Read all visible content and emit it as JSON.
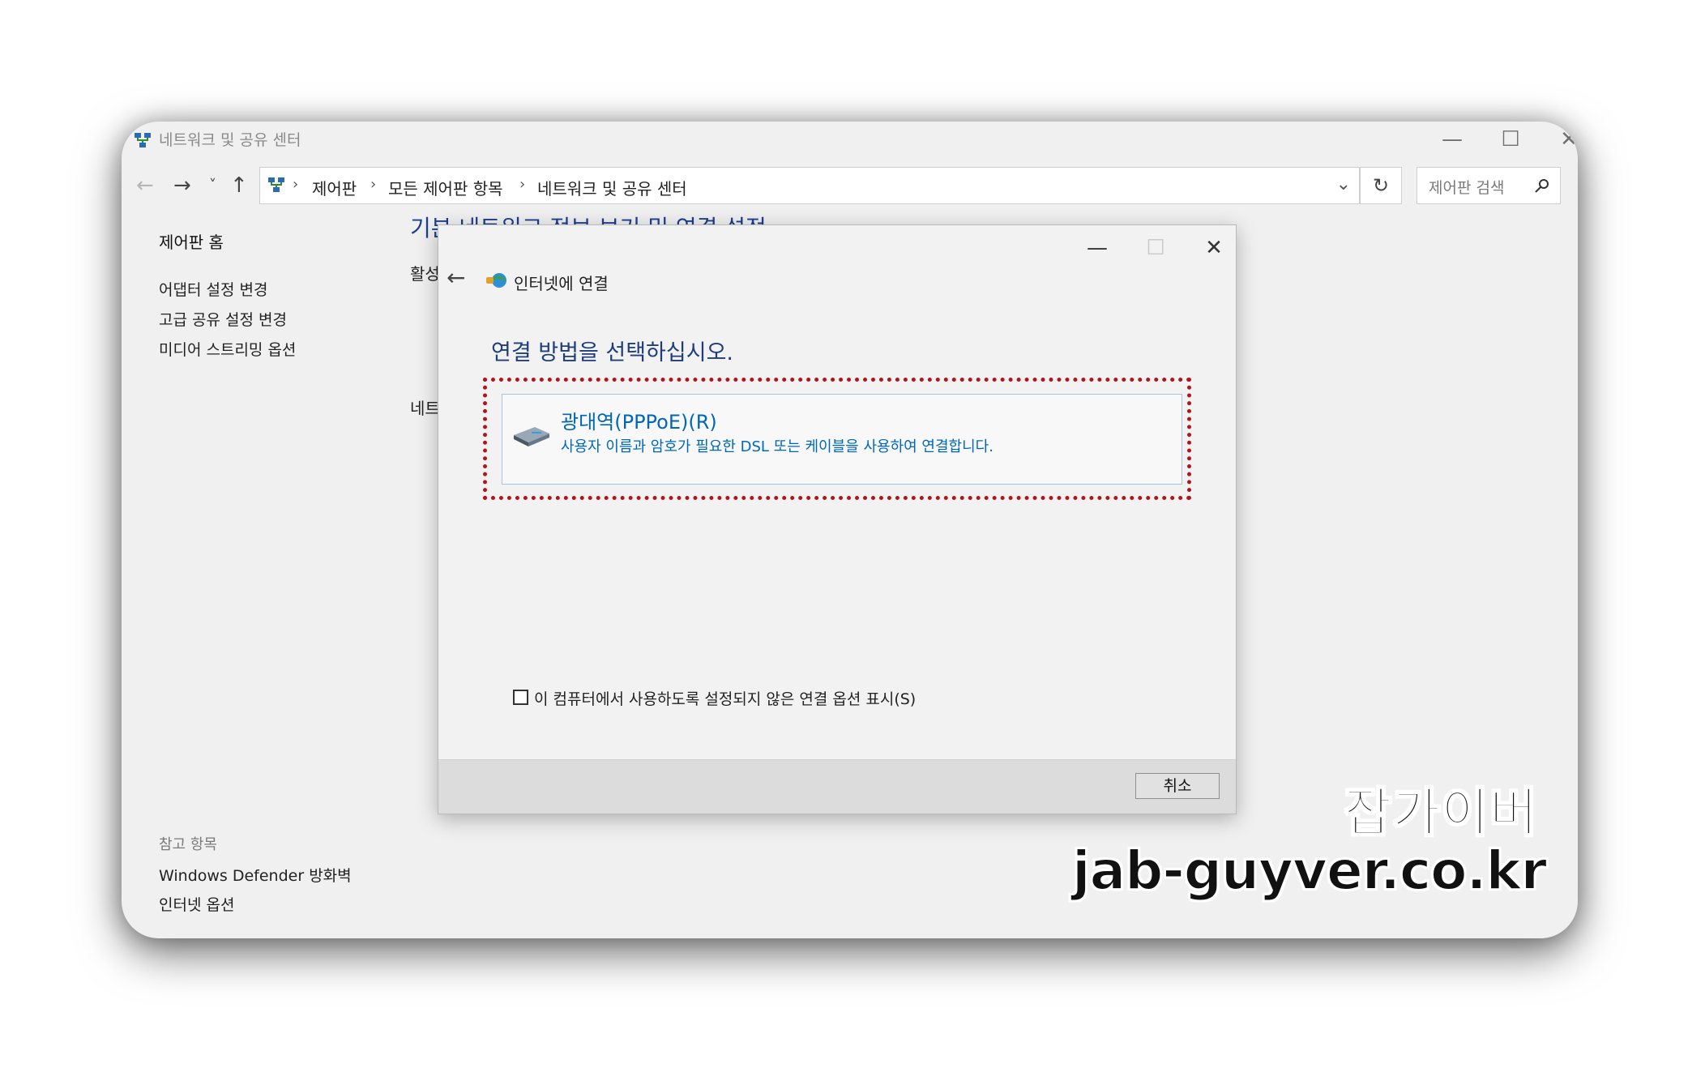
{
  "window": {
    "title": "네트워크 및 공유 센터",
    "minimize": "—",
    "maximize": "☐",
    "close": "✕"
  },
  "nav": {
    "back": "←",
    "forward": "→",
    "recent": "˅",
    "up": "↑",
    "breadcrumbs": [
      "제어판",
      "모든 제어판 항목",
      "네트워크 및 공유 센터"
    ],
    "separator": "›",
    "dropdown": "⌄",
    "refresh": "↻",
    "search_placeholder": "제어판 검색"
  },
  "sidebar": {
    "home": "제어판 홈",
    "links": [
      "어댑터 설정 변경",
      "고급 공유 설정 변경",
      "미디어 스트리밍 옵션"
    ],
    "see_also_header": "참고 항목",
    "see_also": [
      "Windows Defender 방화벽",
      "인터넷 옵션"
    ]
  },
  "main": {
    "title": "기본 네트워크 정보 보기 및 연결 설정",
    "section_active": "활성",
    "section_network": "네트"
  },
  "dialog": {
    "minimize": "—",
    "maximize": "☐",
    "close": "✕",
    "back": "←",
    "title": "인터넷에 연결",
    "heading": "연결 방법을 선택하십시오.",
    "option": {
      "title": "광대역(PPPoE)(R)",
      "description": "사용자 이름과 암호가 필요한 DSL 또는 케이블을 사용하여 연결합니다."
    },
    "checkbox_label": "이 컴퓨터에서 사용하도록 설정되지 않은 연결 옵션 표시(S)",
    "checkbox_checked": false,
    "cancel": "취소"
  },
  "watermark": {
    "name": "잡가이버",
    "url": "jab-guyver.co.kr"
  },
  "colors": {
    "accent_link": "#0067b8",
    "heading_blue": "#1f3d7a",
    "highlight_red": "#b3141b"
  }
}
